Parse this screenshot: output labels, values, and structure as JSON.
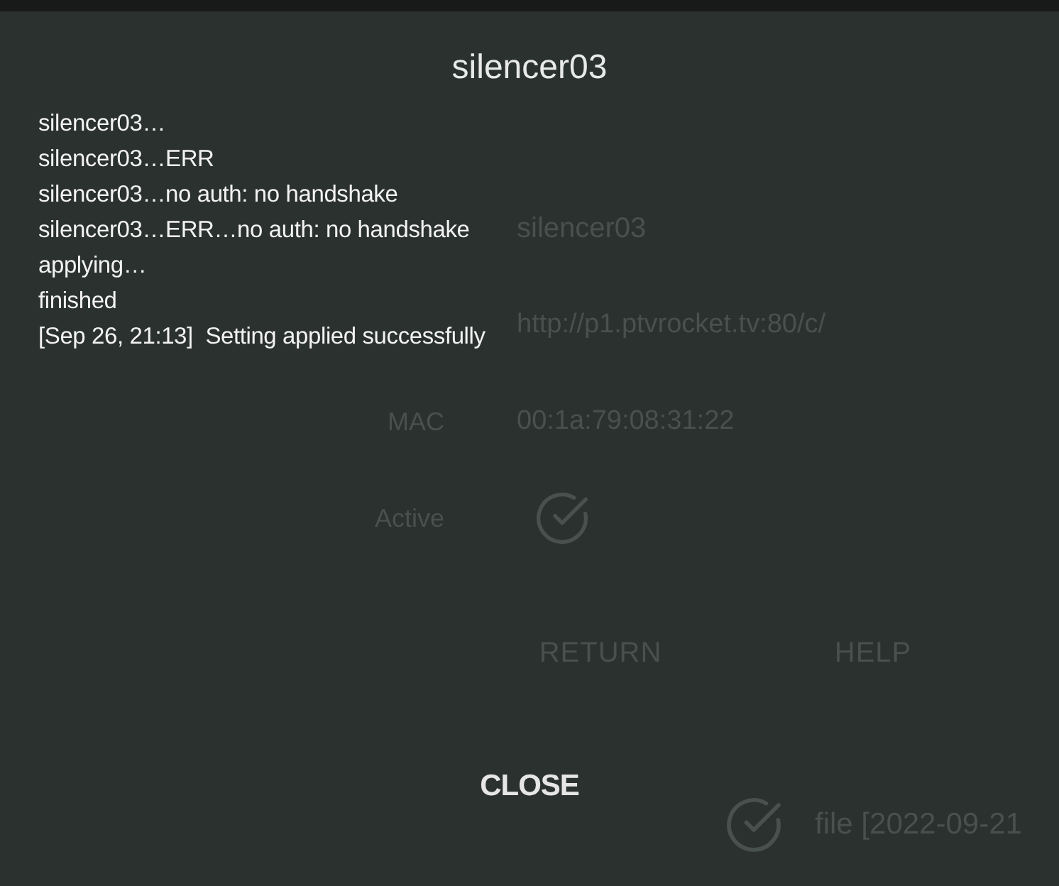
{
  "background": {
    "device_name": "silencer03",
    "url": "http://p1.ptvrocket.tv:80/c/",
    "fields": [
      {
        "kind": "text",
        "label": "MAC",
        "value": "00:1a:79:08:31:22"
      },
      {
        "kind": "check",
        "label": "Active",
        "checked": true
      }
    ],
    "buttons": [
      "RETURN",
      "HELP"
    ],
    "file_entry": {
      "checked": true,
      "text": "file [2022-09-21"
    }
  },
  "dialog": {
    "title": "silencer03",
    "log": [
      "silencer03…",
      "silencer03…ERR",
      "silencer03…no auth: no handshake",
      "silencer03…ERR…no auth: no handshake",
      "applying…",
      "finished",
      "[Sep 26, 21:13]  Setting applied successfully"
    ],
    "close_button": "CLOSE"
  }
}
